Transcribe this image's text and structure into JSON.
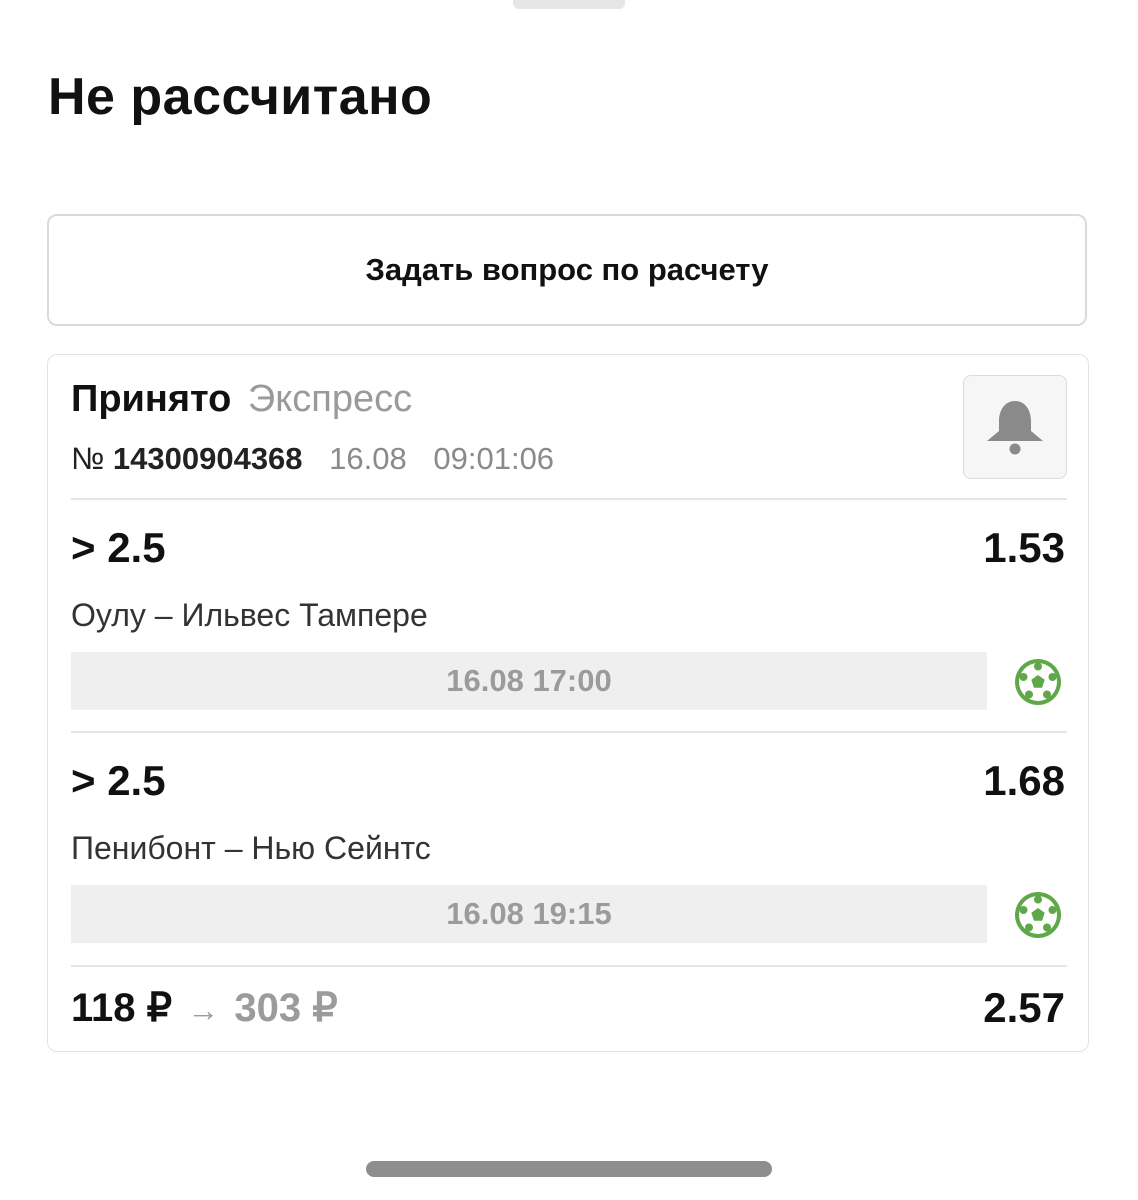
{
  "screen": {
    "title": "Не рассчитано",
    "ask_button_label": "Задать вопрос по расчету"
  },
  "bet": {
    "status": "Принято",
    "type": "Экспресс",
    "number_label": "№",
    "number": "14300904368",
    "date": "16.08",
    "time": "09:01:06",
    "selections": [
      {
        "outcome": "> 2.5",
        "odds": "1.53",
        "event": "Оулу – Ильвес Тампере",
        "start": "16.08 17:00",
        "sport_icon": "soccer-ball-icon"
      },
      {
        "outcome": "> 2.5",
        "odds": "1.68",
        "event": "Пенибонт – Нью Сейнтс",
        "start": "16.08 19:15",
        "sport_icon": "soccer-ball-icon"
      }
    ],
    "stake": "118 ₽",
    "arrow": "→",
    "payout": "303 ₽",
    "total_odds": "2.57"
  },
  "colors": {
    "sport_icon_green": "#5fa84a",
    "muted_text": "#9b9b9b",
    "timebar_bg": "#efefef"
  },
  "icons": {
    "subscribe": "bell-icon",
    "sport": "soccer-ball-icon"
  }
}
